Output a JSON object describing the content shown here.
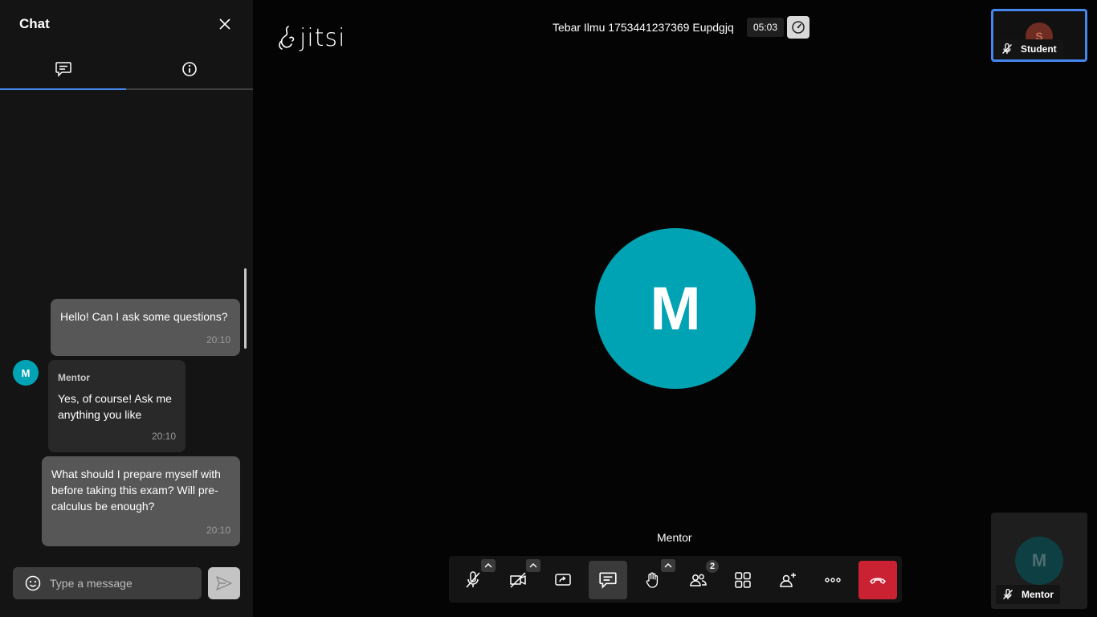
{
  "chat": {
    "title": "Chat",
    "tabs": [
      {
        "icon": "chat-icon"
      },
      {
        "icon": "info-icon"
      }
    ],
    "messages": [
      {
        "text": "Hello! Can I ask some questions?",
        "time": "20:10"
      },
      {
        "sender": "Mentor",
        "avatar": "M",
        "text": "Yes, of course! Ask me anything you like",
        "time": "20:10"
      },
      {
        "text": "What should I prepare myself with before taking this exam? Will pre-calculus be enough?",
        "time": "20:10"
      }
    ],
    "input_placeholder": "Type a message"
  },
  "header": {
    "logo": "jitsi",
    "meeting_title": "Tebar Ilmu 1753441237369 Eupdgjq",
    "timer": "05:03"
  },
  "stage": {
    "dominant_avatar": "M",
    "speaker_name": "Mentor"
  },
  "participants": [
    {
      "name": "Student",
      "avatar": "S",
      "muted": true
    },
    {
      "name": "Mentor",
      "avatar": "M",
      "muted": true
    }
  ],
  "toolbar": {
    "participants_count": "2"
  },
  "colors": {
    "accent": "#4687ed",
    "avatar": "#00a3b3",
    "hangup": "#cb2233"
  }
}
